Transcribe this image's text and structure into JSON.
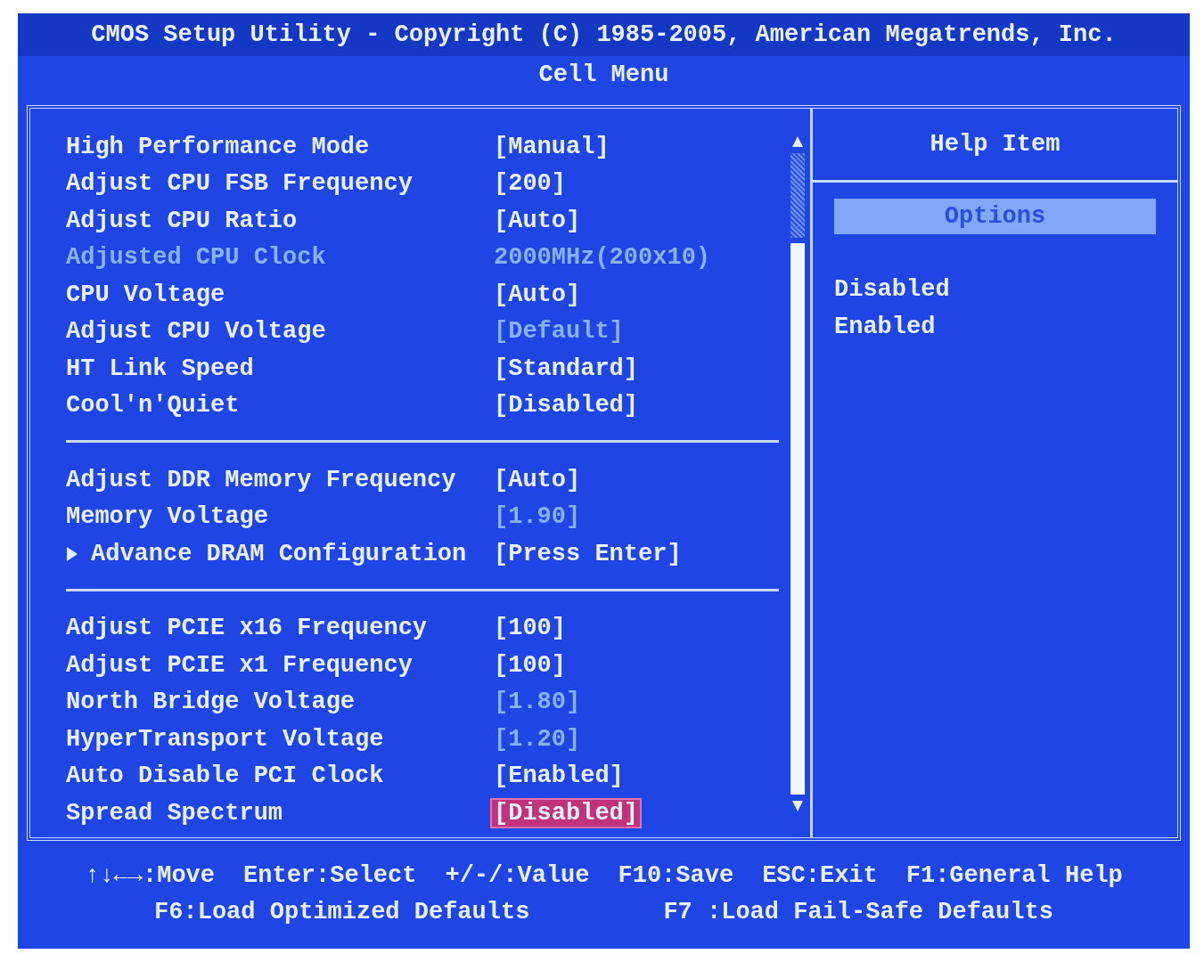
{
  "header": {
    "title": "CMOS Setup Utility - Copyright (C) 1985-2005, American Megatrends, Inc.",
    "subtitle": "Cell Menu"
  },
  "sections": [
    {
      "rows": [
        {
          "kind": "setting",
          "label": "High Performance Mode",
          "label_dimmed": false,
          "value": "[Manual]",
          "value_dimmed": false,
          "selected": false
        },
        {
          "kind": "setting",
          "label": "Adjust CPU FSB Frequency",
          "label_dimmed": false,
          "value": "[200]",
          "value_dimmed": false,
          "selected": false
        },
        {
          "kind": "setting",
          "label": "Adjust CPU Ratio",
          "label_dimmed": false,
          "value": "[Auto]",
          "value_dimmed": false,
          "selected": false
        },
        {
          "kind": "setting",
          "label": "Adjusted CPU Clock",
          "label_dimmed": true,
          "value": "2000MHz(200x10)",
          "value_dimmed": true,
          "selected": false
        },
        {
          "kind": "setting",
          "label": "CPU Voltage",
          "label_dimmed": false,
          "value": "[Auto]",
          "value_dimmed": false,
          "selected": false
        },
        {
          "kind": "setting",
          "label": "Adjust CPU Voltage",
          "label_dimmed": false,
          "value": "[Default]",
          "value_dimmed": true,
          "selected": false
        },
        {
          "kind": "setting",
          "label": "HT Link Speed",
          "label_dimmed": false,
          "value": "[Standard]",
          "value_dimmed": false,
          "selected": false
        },
        {
          "kind": "setting",
          "label": "Cool'n'Quiet",
          "label_dimmed": false,
          "value": "[Disabled]",
          "value_dimmed": false,
          "selected": false
        }
      ]
    },
    {
      "rows": [
        {
          "kind": "setting",
          "label": "Adjust DDR Memory Frequency",
          "label_dimmed": false,
          "value": "[Auto]",
          "value_dimmed": false,
          "selected": false
        },
        {
          "kind": "setting",
          "label": "Memory Voltage",
          "label_dimmed": false,
          "value": "[1.90]",
          "value_dimmed": true,
          "selected": false
        },
        {
          "kind": "submenu",
          "label": "Advance DRAM Configuration",
          "label_dimmed": false,
          "value": "[Press Enter]",
          "value_dimmed": false,
          "selected": false
        }
      ]
    },
    {
      "rows": [
        {
          "kind": "setting",
          "label": "Adjust PCIE x16 Frequency",
          "label_dimmed": false,
          "value": "[100]",
          "value_dimmed": false,
          "selected": false
        },
        {
          "kind": "setting",
          "label": "Adjust PCIE x1 Frequency",
          "label_dimmed": false,
          "value": "[100]",
          "value_dimmed": false,
          "selected": false
        },
        {
          "kind": "setting",
          "label": "North Bridge Voltage",
          "label_dimmed": false,
          "value": "[1.80]",
          "value_dimmed": true,
          "selected": false
        },
        {
          "kind": "setting",
          "label": "HyperTransport Voltage",
          "label_dimmed": false,
          "value": "[1.20]",
          "value_dimmed": true,
          "selected": false
        },
        {
          "kind": "setting",
          "label": "Auto Disable PCI Clock",
          "label_dimmed": false,
          "value": "[Enabled]",
          "value_dimmed": false,
          "selected": false
        },
        {
          "kind": "setting",
          "label": "Spread Spectrum",
          "label_dimmed": false,
          "value": "[Disabled]",
          "value_dimmed": false,
          "selected": true
        }
      ]
    }
  ],
  "help": {
    "title": "Help Item",
    "options_heading": "Options",
    "options": [
      "Disabled",
      "Enabled"
    ]
  },
  "footer": {
    "lines": [
      [
        "↑↓←→:Move",
        "Enter:Select",
        "+/-/:Value",
        "F10:Save",
        "ESC:Exit",
        "F1:General Help"
      ],
      [
        "F6:Load Optimized Defaults",
        "F7 :Load Fail-Safe Defaults"
      ]
    ]
  }
}
